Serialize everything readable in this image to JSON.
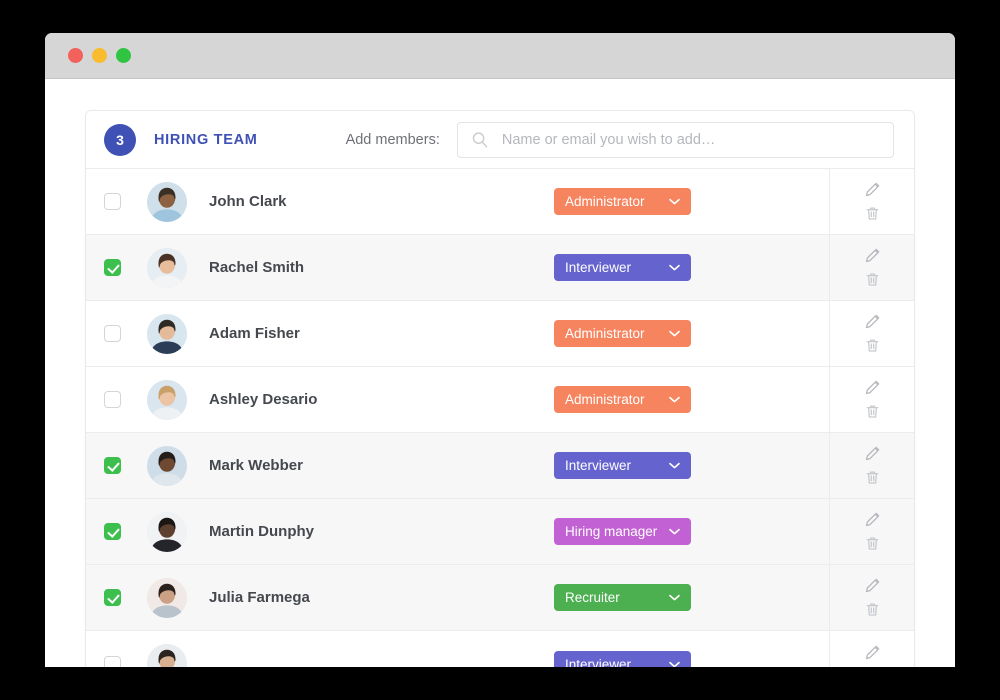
{
  "window": {
    "controls": [
      {
        "name": "close",
        "color": "#f2615c"
      },
      {
        "name": "minimize",
        "color": "#f8bc2e"
      },
      {
        "name": "maximize",
        "color": "#2fc543"
      }
    ]
  },
  "header": {
    "count": "3",
    "title": "HIRING TEAM",
    "add_members_label": "Add members:",
    "search_placeholder": "Name or email you wish to add…",
    "search_value": "",
    "search_icon": "search-icon",
    "accent_color": "#3f51b5"
  },
  "role_colors": {
    "Administrator": "#f5845f",
    "Interviewer": "#6563ce",
    "Hiring manager": "#c261d4",
    "Recruiter": "#4caf50"
  },
  "actions": {
    "edit_icon": "pencil-icon",
    "delete_icon": "trash-icon"
  },
  "members": [
    {
      "name": "John Clark",
      "role": "Administrator",
      "selected": false,
      "avatar": "man-1"
    },
    {
      "name": "Rachel Smith",
      "role": "Interviewer",
      "selected": true,
      "avatar": "woman-1"
    },
    {
      "name": "Adam Fisher",
      "role": "Administrator",
      "selected": false,
      "avatar": "man-2"
    },
    {
      "name": "Ashley Desario",
      "role": "Administrator",
      "selected": false,
      "avatar": "woman-2"
    },
    {
      "name": "Mark Webber",
      "role": "Interviewer",
      "selected": true,
      "avatar": "man-3"
    },
    {
      "name": "Martin Dunphy",
      "role": "Hiring manager",
      "selected": true,
      "avatar": "man-4"
    },
    {
      "name": "Julia Farmega",
      "role": "Recruiter",
      "selected": true,
      "avatar": "woman-3"
    },
    {
      "name": "",
      "role": "Interviewer",
      "selected": false,
      "avatar": "woman-4"
    }
  ]
}
